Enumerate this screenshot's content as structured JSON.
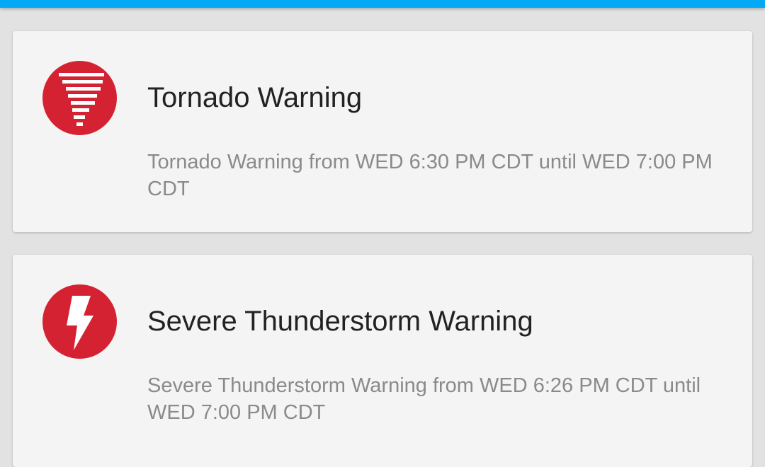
{
  "colors": {
    "top_bar": "#03a9f4",
    "background": "#e2e2e2",
    "card": "#f4f4f4",
    "alert_icon": "#d52232",
    "title_text": "#222222",
    "description_text": "#8a8a8a"
  },
  "alerts": [
    {
      "icon": "tornado-icon",
      "title": "Tornado Warning",
      "description": "Tornado Warning from WED 6:30 PM CDT until WED 7:00 PM CDT"
    },
    {
      "icon": "lightning-bolt-icon",
      "title": "Severe Thunderstorm Warning",
      "description": "Severe Thunderstorm Warning from WED 6:26 PM CDT until WED 7:00 PM CDT"
    }
  ]
}
